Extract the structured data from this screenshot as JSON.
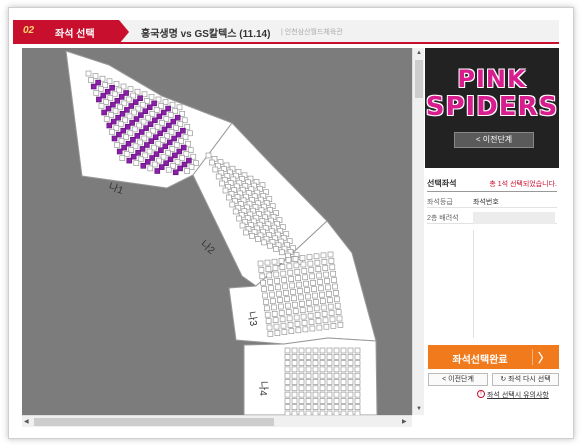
{
  "header": {
    "step_number": "02",
    "step_label": "좌석 선택",
    "game_title": "흥국생명 vs GS칼텍스 (11.14)",
    "venue": "| 인천삼산월드체육관"
  },
  "map": {
    "sections": [
      {
        "label": "나1"
      },
      {
        "label": "나2"
      },
      {
        "label": "나3"
      },
      {
        "label": "나4"
      }
    ],
    "colors": {
      "background": "#7c7c7c",
      "section_fill": "#ffffff",
      "seat_available": "#8a1fa8",
      "seat_taken": "#ffffff"
    }
  },
  "sidebar": {
    "logo_line1": "PINK",
    "logo_line2": "SPIDERS",
    "prev_step_top": "< 이전단계",
    "selection_title": "선택좌석",
    "selection_note": "총 1석 선택되었습니다.",
    "rows": [
      {
        "label": "좌석등급",
        "value": "좌석번호"
      },
      {
        "label": "2층 배려석",
        "value": ""
      }
    ],
    "complete_button": "좌석선택완료",
    "complete_arrow": "〉",
    "prev_step_small": "< 이전단계",
    "reselect": "↻ 좌석 다시 선택",
    "notice_icon": "!",
    "notice": "좌석 선택시 유의사항"
  },
  "scroll": {
    "up": "▲",
    "down": "▼",
    "left": "◀",
    "right": "▶"
  }
}
